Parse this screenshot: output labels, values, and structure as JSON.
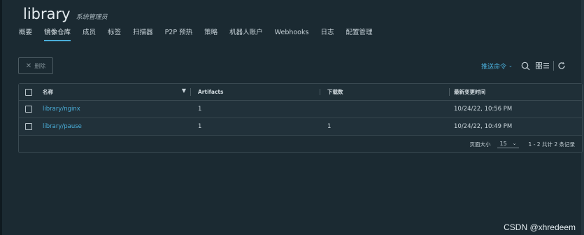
{
  "header": {
    "title": "library",
    "subtitle": "系统管理员"
  },
  "tabs": [
    {
      "label": "概要"
    },
    {
      "label": "镜像仓库",
      "active": true
    },
    {
      "label": "成员"
    },
    {
      "label": "标签"
    },
    {
      "label": "扫描器"
    },
    {
      "label": "P2P 预热"
    },
    {
      "label": "策略"
    },
    {
      "label": "机器人账户"
    },
    {
      "label": "Webhooks"
    },
    {
      "label": "日志"
    },
    {
      "label": "配置管理"
    }
  ],
  "toolbar": {
    "delete_label": "删除",
    "push_command_label": "推送命令"
  },
  "table": {
    "columns": {
      "name": "名称",
      "artifacts": "Artifacts",
      "downloads": "下载数",
      "updated": "最新变更时间"
    },
    "rows": [
      {
        "name": "library/nginx",
        "artifacts": "1",
        "downloads": "",
        "updated": "10/24/22, 10:56 PM"
      },
      {
        "name": "library/pause",
        "artifacts": "1",
        "downloads": "1",
        "updated": "10/24/22, 10:49 PM"
      }
    ]
  },
  "footer": {
    "page_size_label": "页面大小",
    "page_size_value": "15",
    "summary": "1 - 2 共计 2 条记录"
  },
  "watermark": "CSDN @xhredeem",
  "colors": {
    "background": "#1b2a32",
    "accent": "#4aaed9",
    "text": "#c8d3d9"
  }
}
